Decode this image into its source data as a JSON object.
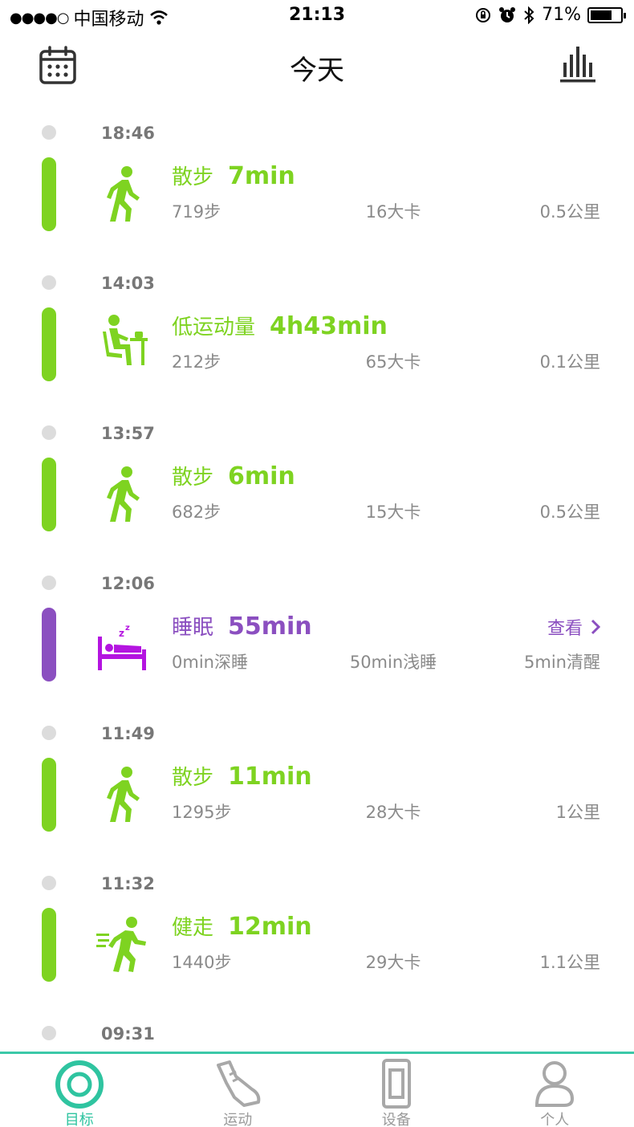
{
  "status_bar": {
    "signal_dots": "●●●●○",
    "carrier": "中国移动",
    "time": "21:13",
    "battery_percent": "71%",
    "icons": [
      "wifi-icon",
      "rotation-lock-icon",
      "alarm-icon",
      "bluetooth-icon",
      "battery-icon"
    ]
  },
  "header": {
    "title": "今天",
    "left_icon": "calendar-icon",
    "right_icon": "bar-chart-icon"
  },
  "colors": {
    "activity_green": "#7ed321",
    "sleep_purple": "#8b4fc0",
    "sleep_icon_purple": "#b414e0",
    "tab_active": "#2fc4a0",
    "tab_border": "#3cc8a8"
  },
  "timeline": {
    "entries": [
      {
        "time": "18:46",
        "kind": "activity",
        "icon": "walking-icon",
        "title": "散步",
        "duration": "7min",
        "stats": [
          "719步",
          "16大卡",
          "0.5公里"
        ]
      },
      {
        "time": "14:03",
        "kind": "activity",
        "icon": "sitting-desk-icon",
        "title": "低运动量",
        "duration": "4h43min",
        "stats": [
          "212步",
          "65大卡",
          "0.1公里"
        ]
      },
      {
        "time": "13:57",
        "kind": "activity",
        "icon": "walking-icon",
        "title": "散步",
        "duration": "6min",
        "stats": [
          "682步",
          "15大卡",
          "0.5公里"
        ]
      },
      {
        "time": "12:06",
        "kind": "sleep",
        "icon": "sleeping-bed-icon",
        "title": "睡眠",
        "duration": "55min",
        "link": "查看",
        "stats": [
          "0min深睡",
          "50min浅睡",
          "5min清醒"
        ]
      },
      {
        "time": "11:49",
        "kind": "activity",
        "icon": "walking-icon",
        "title": "散步",
        "duration": "11min",
        "stats": [
          "1295步",
          "28大卡",
          "1公里"
        ]
      },
      {
        "time": "11:32",
        "kind": "activity",
        "icon": "brisk-walking-icon",
        "title": "健走",
        "duration": "12min",
        "stats": [
          "1440步",
          "29大卡",
          "1.1公里"
        ]
      },
      {
        "time": "09:31",
        "kind": "partial",
        "icon": "",
        "title": "",
        "duration": "",
        "stats": [
          "",
          "",
          ""
        ]
      }
    ]
  },
  "tab_bar": {
    "tabs": [
      {
        "label": "目标",
        "icon": "target-icon",
        "active": true
      },
      {
        "label": "运动",
        "icon": "sneaker-icon",
        "active": false
      },
      {
        "label": "设备",
        "icon": "band-device-icon",
        "active": false
      },
      {
        "label": "个人",
        "icon": "person-icon",
        "active": false
      }
    ]
  }
}
